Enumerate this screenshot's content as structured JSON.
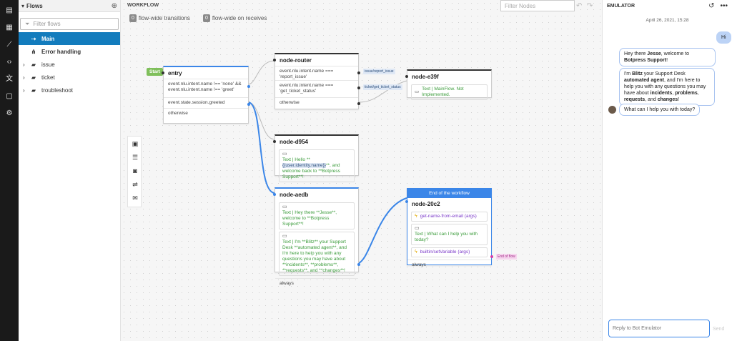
{
  "rail": {
    "icons": [
      "document-icon",
      "layout-icon",
      "chart-icon",
      "code-icon",
      "translate-icon",
      "chat-icon",
      "gear-icon"
    ]
  },
  "sidebar": {
    "title": "Flows",
    "filter_placeholder": "Filter flows",
    "items": [
      {
        "label": "Main",
        "icon": "flow-icon",
        "active": true
      },
      {
        "label": "Error handling",
        "icon": "share-icon",
        "active": false
      },
      {
        "label": "issue",
        "icon": "folder-icon",
        "active": false
      },
      {
        "label": "ticket",
        "icon": "folder-icon",
        "active": false
      },
      {
        "label": "troubleshoot",
        "icon": "folder-icon",
        "active": false
      }
    ]
  },
  "workflow": {
    "title": "WORKFLOW",
    "badge1_count": "0",
    "badge1_label": "flow-wide transitions",
    "badge2_count": "0",
    "badge2_label": "flow-wide on receives",
    "filter_placeholder": "Filter Nodes"
  },
  "nodes": {
    "start_label": "Start",
    "entry": {
      "title": "entry",
      "cond1": "event.nlu.intent.name !== 'none' && event.nlu.intent.name !== 'greet'",
      "cond2": "event.state.session.greeted",
      "cond3": "otherwise"
    },
    "router": {
      "title": "node-router",
      "cond1": "event.nlu.intent.name === 'report_issue'",
      "tag1": "issue/report_issue",
      "cond2": "event.nlu.intent.name === 'get_ticket_status'",
      "tag2": "ticket/get_ticket_status",
      "cond3": "otherwise"
    },
    "e39f": {
      "title": "node-e39f",
      "text": "Text | MainFlow. Not Implemented."
    },
    "d954": {
      "title": "node-d954",
      "text_a": "Text | Hello **",
      "text_var": "{{user.identity.name}}",
      "text_b": "**, and welcome back to **Botpress Support**!"
    },
    "aedb": {
      "title": "node-aedb",
      "text1": "Text | Hey there **Jesse**, welcome to **Botpress Support**!",
      "text2": "Text | I'm **Blitz** your Support Desk **automated agent**, and I'm here to help you with any questions you may have about **incidents**, **problems**, **requests**, and **changes**!",
      "cond": "always"
    },
    "n20c2": {
      "header": "End of the workflow",
      "title": "node-20c2",
      "action1": "get-name-from-email (args)",
      "text": "Text | What can I help you with today?",
      "action2": "builtin/setVariable (args)",
      "cond": "always",
      "tag": "End of flow"
    }
  },
  "emulator": {
    "title": "EMULATOR",
    "date": "April 26, 2021, 15:28",
    "user_msg": "Hi",
    "bot_msg1_parts": [
      "Hey there ",
      "Jesse",
      ", welcome to ",
      "Botpress Support",
      "!"
    ],
    "bot_msg2_parts": [
      "I'm ",
      "Blitz",
      " your Support Desk ",
      "automated agent",
      ", and I'm here to help you with any questions you may have about ",
      "incidents",
      ", ",
      "problems",
      ", ",
      "requests",
      ", and ",
      "changes",
      "!"
    ],
    "bot_msg3": "What can I help you with today?",
    "reply_placeholder": "Reply to Bot Emulator",
    "send_label": "Send"
  },
  "colors": {
    "accent": "#137cbd",
    "wire_blue": "#3b86e8",
    "start_green": "#7fbf5b",
    "text_green": "#3a9b3a",
    "action_purple": "#7b39c9"
  }
}
